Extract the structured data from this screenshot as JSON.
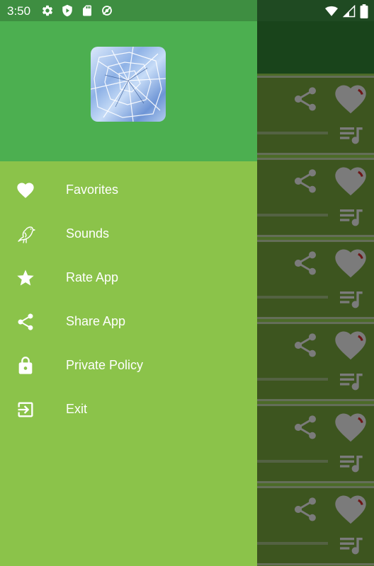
{
  "status_bar": {
    "time": "3:50",
    "left_icons": [
      "settings-icon",
      "shield-play-icon",
      "sd-card-icon",
      "location-off-icon"
    ],
    "right_icons": [
      "wifi-icon",
      "signal-icon",
      "battery-icon"
    ]
  },
  "drawer": {
    "logo": "shattered-glass-logo",
    "menu_items": [
      {
        "icon": "heart-icon",
        "label": "Favorites"
      },
      {
        "icon": "bird-icon",
        "label": "Sounds"
      },
      {
        "icon": "star-icon",
        "label": "Rate App"
      },
      {
        "icon": "share-icon",
        "label": "Share App"
      },
      {
        "icon": "lock-icon",
        "label": "Private Policy"
      },
      {
        "icon": "exit-icon",
        "label": "Exit"
      }
    ]
  },
  "background_list": {
    "card_icons": [
      "share-icon",
      "heart-icon",
      "playlist-icon"
    ],
    "card_count": 6
  },
  "colors": {
    "drawer_bg": "#8bc34a",
    "drawer_header": "#4caf50",
    "status_bar": "#3e8e41",
    "text": "#ffffff"
  }
}
